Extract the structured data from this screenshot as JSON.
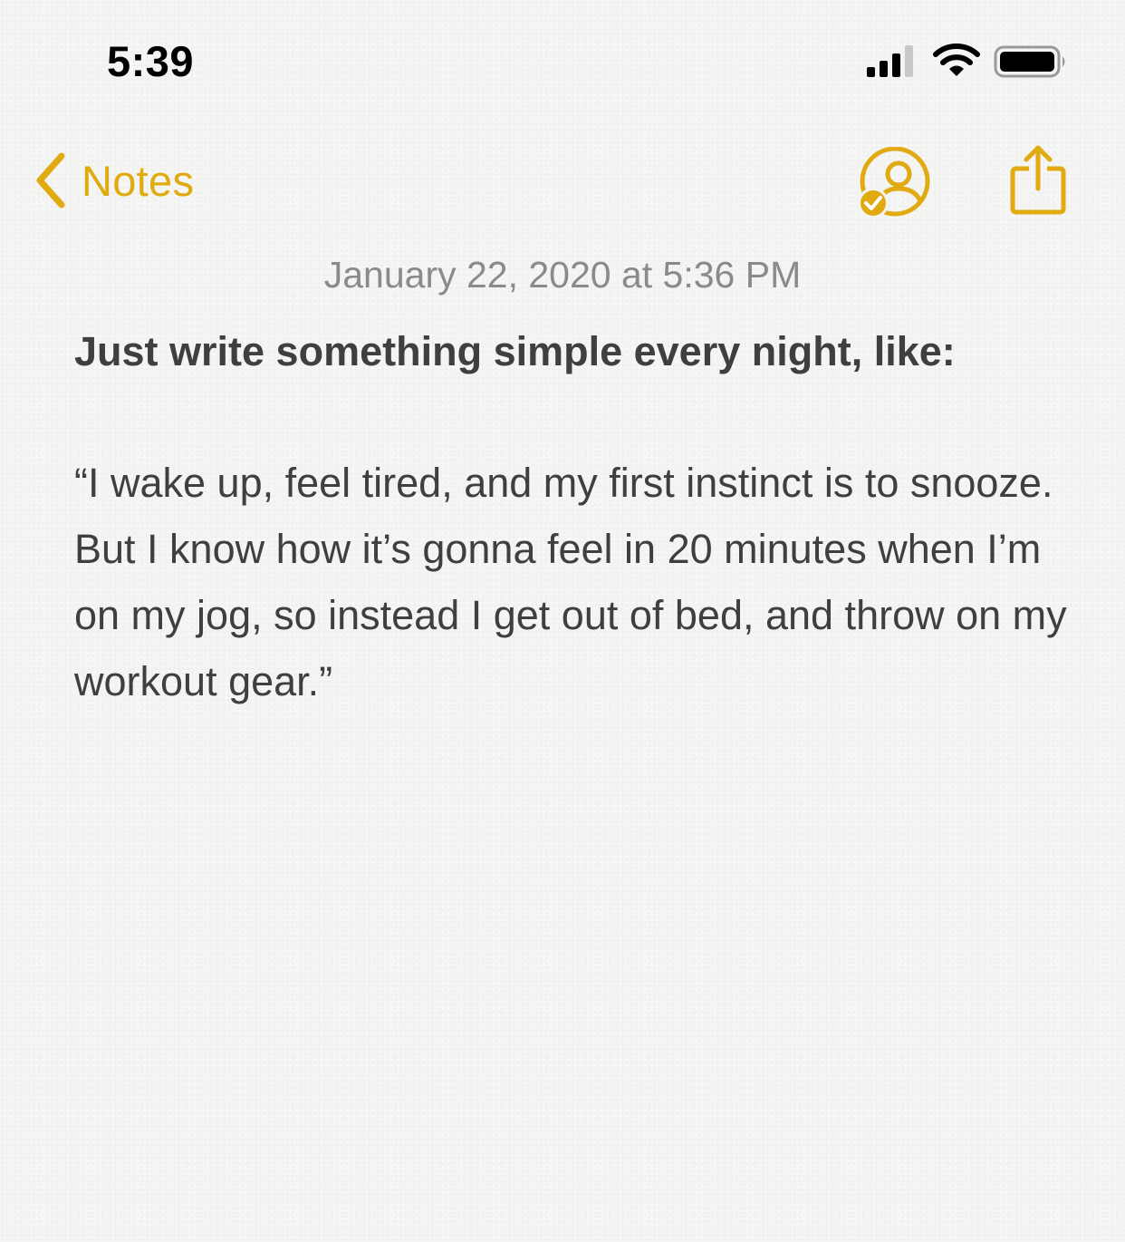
{
  "status_bar": {
    "time": "5:39",
    "icons": [
      "signal-icon",
      "wifi-icon",
      "battery-icon"
    ]
  },
  "nav": {
    "back_label": "Notes",
    "icons": [
      "chevron-left-icon",
      "collaborate-icon",
      "share-icon"
    ]
  },
  "note": {
    "date": "January 22, 2020 at 5:36 PM",
    "heading": "Just write something simple every night, like:",
    "quote": "“I wake up, feel tired, and my first instinct is to snooze. But I know how it’s gonna feel in 20 minutes when I’m on my jog, so instead I get out of bed, and throw on my workout gear.”"
  },
  "colors": {
    "accent": "#e0aa10",
    "text": "#3f3f3f",
    "secondary_text": "#8a8a8a",
    "background": "#f4f4f2"
  }
}
